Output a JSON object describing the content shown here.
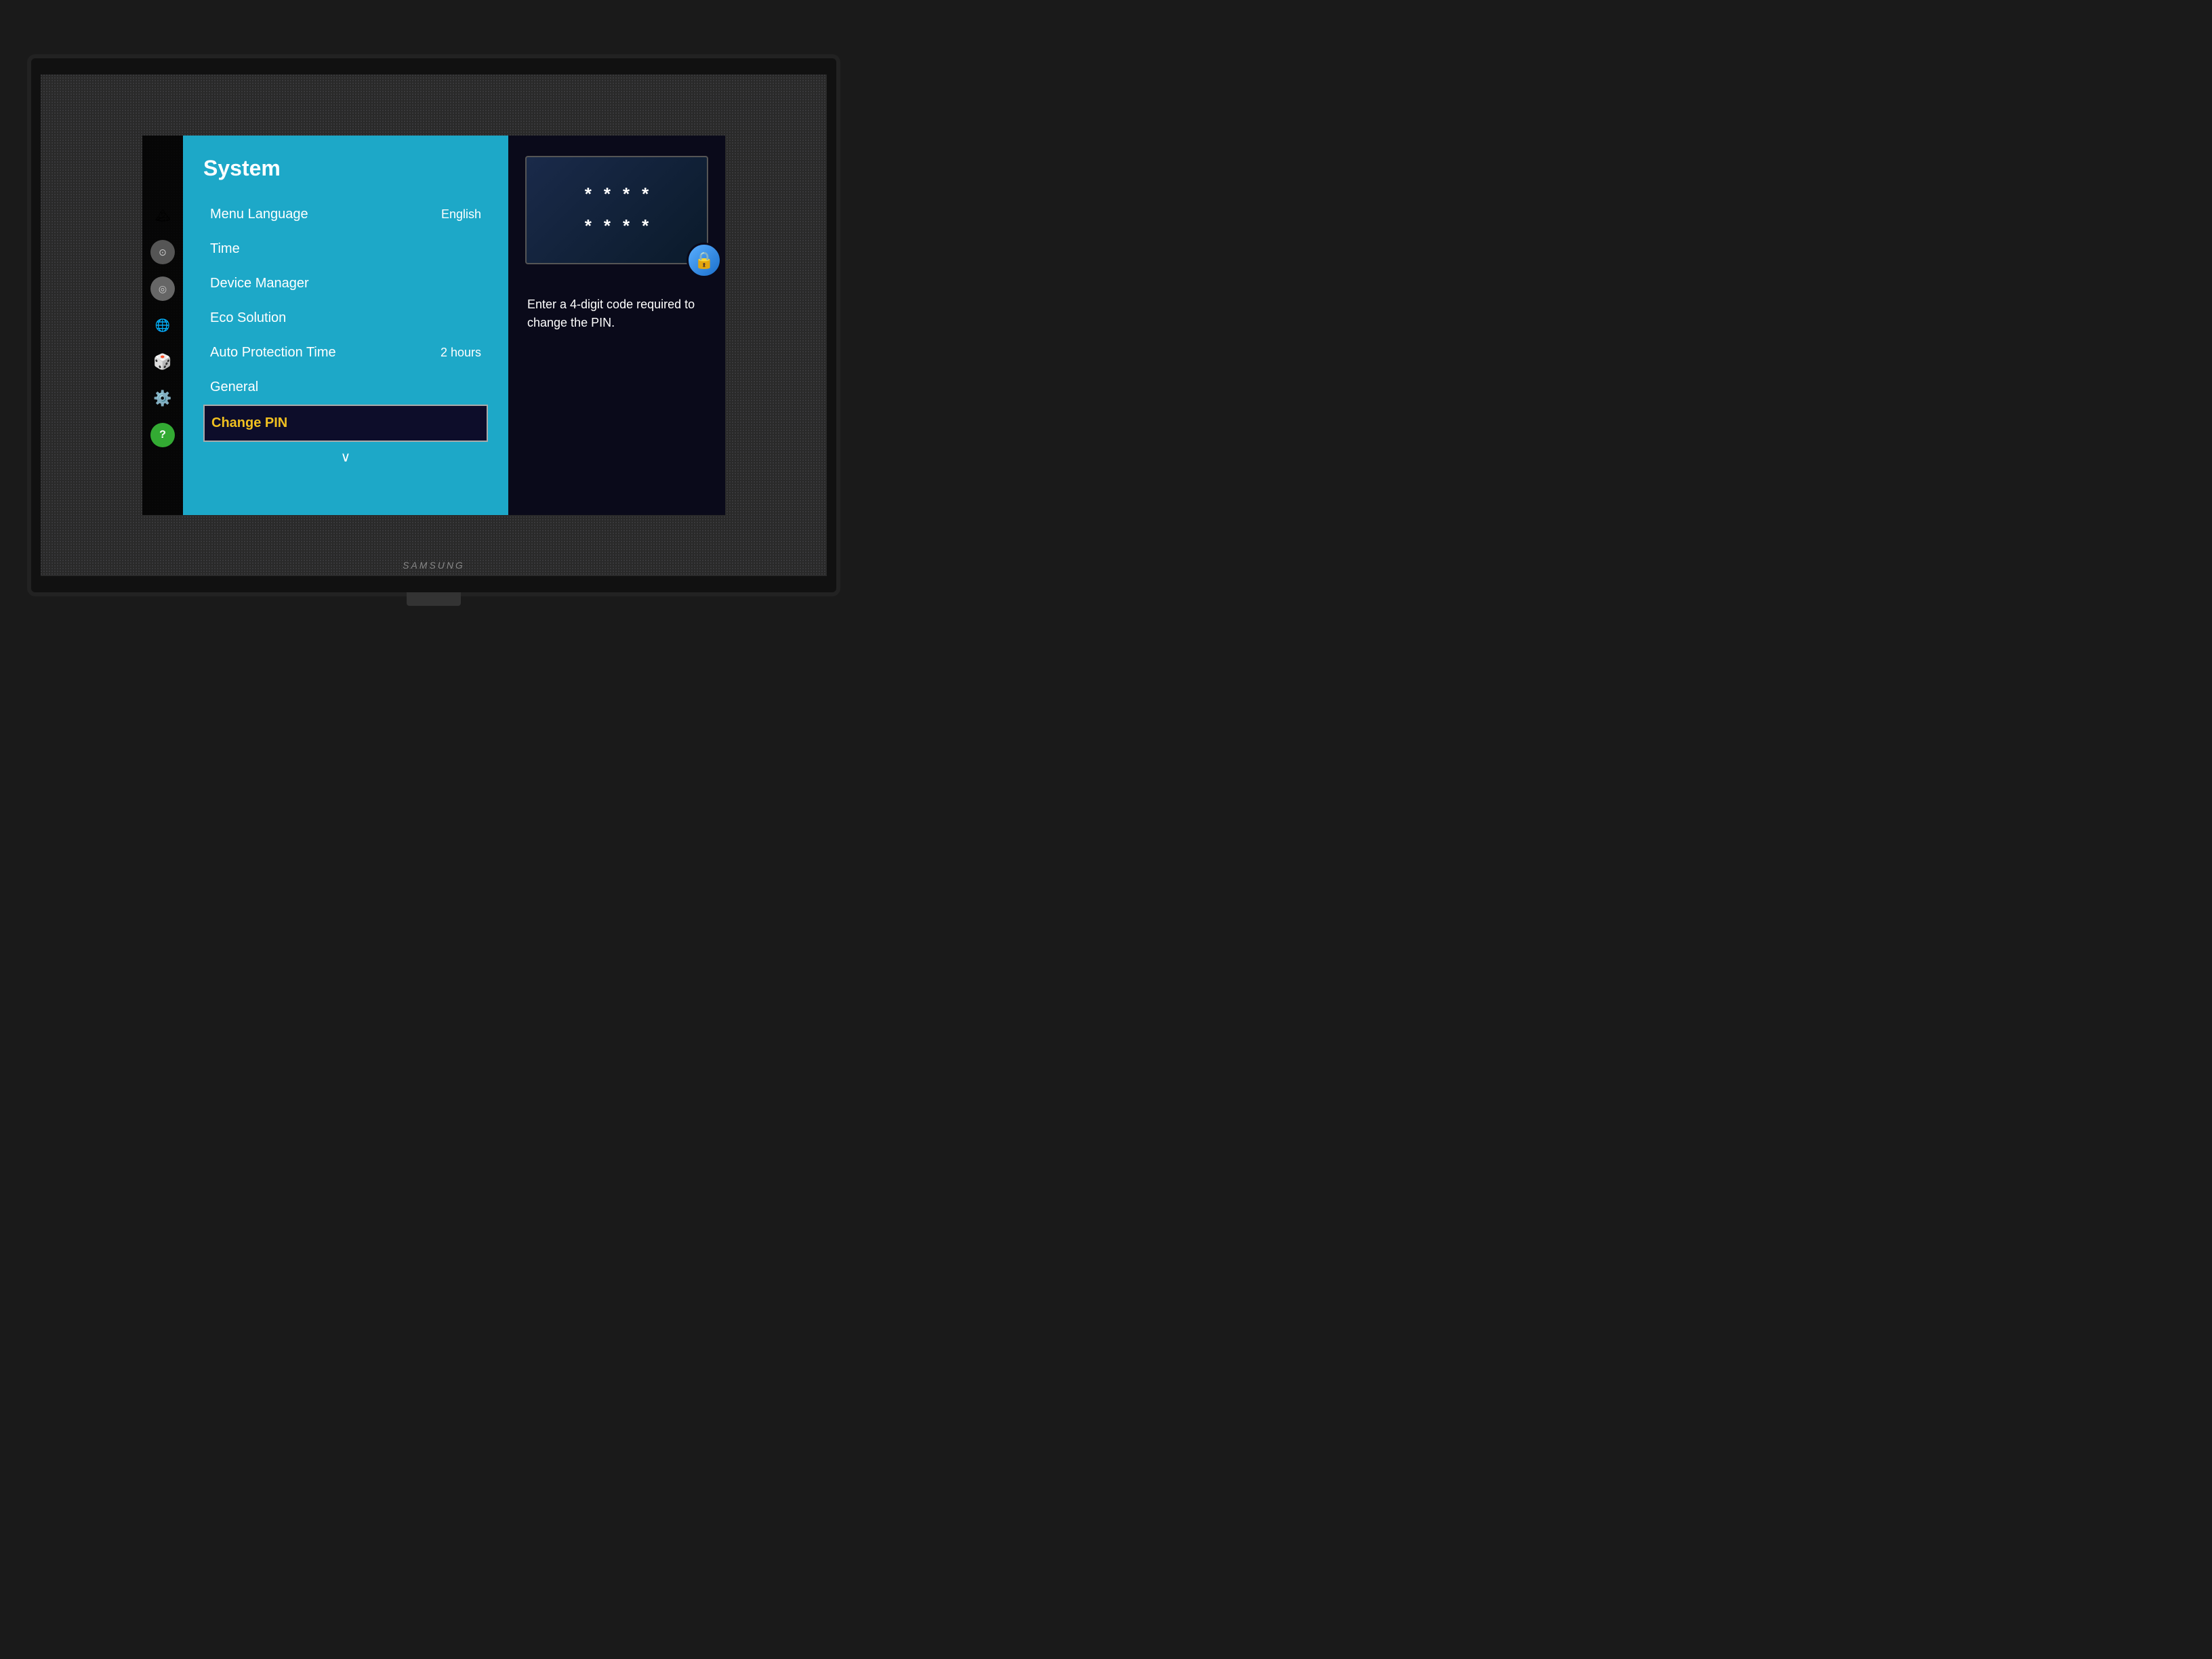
{
  "tv": {
    "brand": "SAMSUNG"
  },
  "sidebar": {
    "icons": [
      {
        "name": "flag-icon",
        "symbol": "🏔",
        "label": "Flag/Picture"
      },
      {
        "name": "camera-icon",
        "symbol": "⊙",
        "label": "Camera"
      },
      {
        "name": "mic-icon",
        "symbol": "◎",
        "label": "Microphone"
      },
      {
        "name": "globe-icon",
        "symbol": "🌐",
        "label": "Globe"
      },
      {
        "name": "cube-icon",
        "symbol": "◈",
        "label": "3D Cube"
      },
      {
        "name": "gear-icon",
        "symbol": "⚙",
        "label": "Settings"
      },
      {
        "name": "help-icon",
        "symbol": "?",
        "label": "Help"
      }
    ]
  },
  "system_menu": {
    "title": "System",
    "items": [
      {
        "label": "Menu Language",
        "value": "English",
        "active": false
      },
      {
        "label": "Time",
        "value": "",
        "active": false
      },
      {
        "label": "Device Manager",
        "value": "",
        "active": false
      },
      {
        "label": "Eco Solution",
        "value": "",
        "active": false
      },
      {
        "label": "Auto Protection Time",
        "value": "2 hours",
        "active": false
      },
      {
        "label": "General",
        "value": "",
        "active": false
      },
      {
        "label": "Change PIN",
        "value": "",
        "active": true
      }
    ],
    "scroll_down_indicator": "∨"
  },
  "pin_panel": {
    "dots_row1": [
      "*",
      "*",
      "*",
      "*"
    ],
    "dots_row2": [
      "*",
      "*",
      "*",
      "*"
    ],
    "lock_symbol": "🔒",
    "description": "Enter a 4-digit code required to change the PIN."
  }
}
